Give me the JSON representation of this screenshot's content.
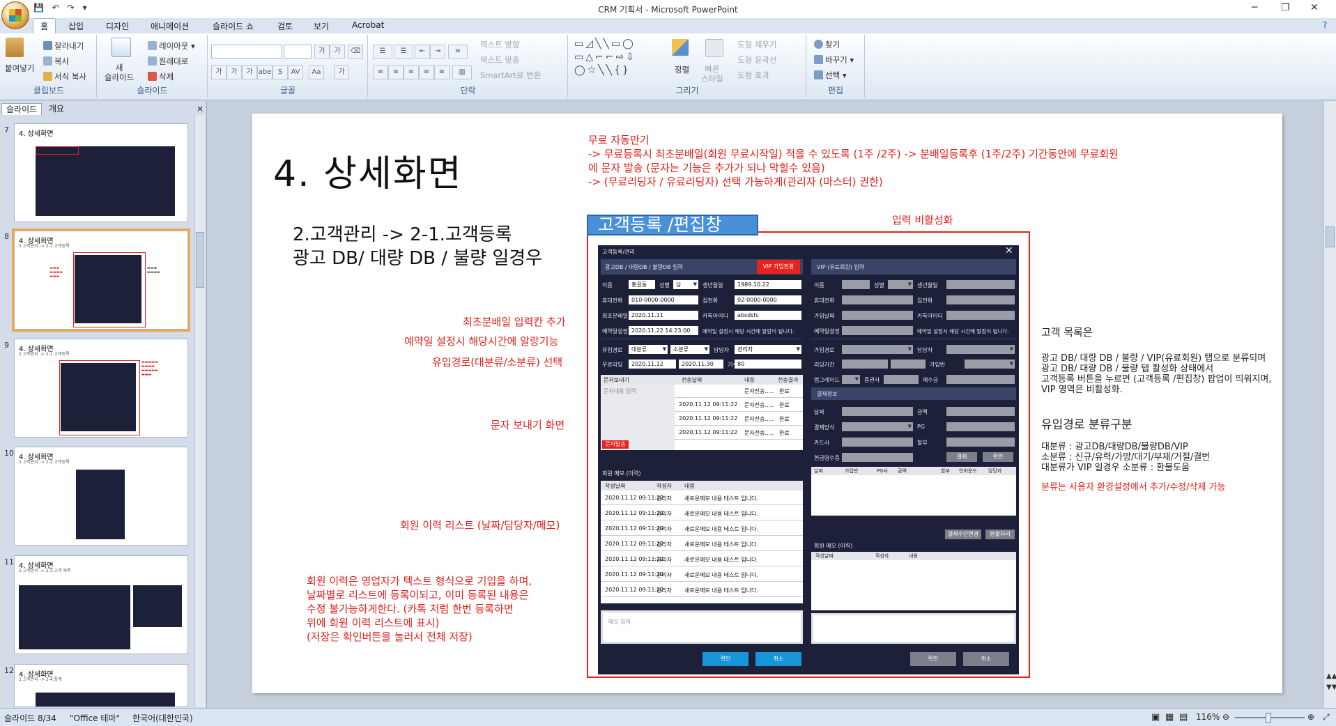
{
  "window": {
    "title": "CRM 기획서 - Microsoft PowerPoint",
    "minimize": "─",
    "restore": "❐",
    "close": "✕",
    "help": "?"
  },
  "qat": {
    "save": "💾",
    "undo": "↶",
    "redo": "↷",
    "more": "▾"
  },
  "tabs": [
    "홈",
    "삽입",
    "디자인",
    "애니메이션",
    "슬라이드 쇼",
    "검토",
    "보기",
    "Acrobat"
  ],
  "ribbon": {
    "clipboard": {
      "label": "클립보드",
      "paste": "붙여넣기",
      "cut": "잘라내기",
      "copy": "복사",
      "format_painter": "서식 복사"
    },
    "slides": {
      "label": "슬라이드",
      "new_slide": "새\n슬라이드",
      "layout": "레이아웃",
      "reset": "원래대로",
      "delete": "삭제"
    },
    "font": {
      "label": "글꼴",
      "grow": "가",
      "shrink": "가",
      "bold": "가",
      "italic": "가",
      "underline": "가",
      "strike": "abe",
      "shadow": "S",
      "spacing": "AV",
      "case": "Aa",
      "color": "가"
    },
    "paragraph": {
      "label": "단락",
      "text_direction": "텍스트 방향",
      "align_text": "텍스트 맞춤",
      "smartart": "SmartArt로 변환"
    },
    "drawing": {
      "label": "그리기",
      "arrange": "정렬",
      "quick_styles": "빠른\n스타일",
      "fill": "도형 채우기",
      "outline": "도형 윤곽선",
      "effects": "도형 효과"
    },
    "editing": {
      "label": "편집",
      "find": "찾기",
      "replace": "바꾸기",
      "select": "선택"
    }
  },
  "panel": {
    "tab_slides": "슬라이드",
    "tab_outline": "개요",
    "close": "×"
  },
  "thumbnails": [
    {
      "num": "7",
      "title": "4. 상세화면"
    },
    {
      "num": "8",
      "title": "4. 상세화면",
      "sub": "2.고객관리 -> 2-1.고객등록"
    },
    {
      "num": "9",
      "title": "4. 상세화면",
      "sub": "2.고객관리 -> 2-1.고객등록"
    },
    {
      "num": "10",
      "title": "4. 상세화면",
      "sub": "2.고객관리 -> 2-2.고객등록"
    },
    {
      "num": "11",
      "title": "4. 상세화면",
      "sub": "2.고객관리 -> 2-3.고객 목록"
    },
    {
      "num": "12",
      "title": "4. 상세화면",
      "sub": "2.고객관리 -> 2-4.통계"
    }
  ],
  "slide": {
    "title": "4. 상세화면",
    "subtitle1": "2.고객관리 -> 2-1.고객등록",
    "subtitle2": "광고 DB/ 대량 DB / 불량 일경우",
    "top_note": [
      "무료 자동만기",
      "-> 무료등록시 최초분배일(회원 무료시작일) 적을 수 있도록 (1주 /2주) -> 분배일등록후 (1주/2주) 기간동안에 무료회원",
      "에 문자 발송 (문자는 기능은 추가가 되나 막힐수 있음)",
      "-> (무료리딩자 / 유료리딩자) 선택 가능하게(관리자 (마스터) 권한)"
    ],
    "box_label": "고객등록 /편집창",
    "inactive_label": "입력 비활성화",
    "notes_left": [
      "최초분배일 입력칸 추가",
      "예약일 설정시 해당시간에 알랑기능",
      "유입경로(대분류/소분류) 선택"
    ],
    "sms_label": "문자 보내기 화면",
    "history_label": "회원 이력 리스트 (날짜/담당자/메모)",
    "history_note": [
      "회원 이력은 영업자가 텍스트 형식으로 기입을 하며,",
      "날짜별로 리스트에 등록이되고, 이미 등록된 내용은",
      "수정 불가능하게한다. (카톡 처럼 한번 등록하면",
      "위에 회원 이력 리스트에 표시)",
      "(저장은 확인버튼을 눌러서 전체 저장)"
    ],
    "right_heading1": "고객 목록은",
    "right_text1": [
      "광고 DB/ 대량 DB / 불량 / VIP(유료회원) 탭으로 분류되며",
      "광고 DB/ 대량 DB / 불량 탭 활성화 상태에서",
      "고객등록 버튼을 누르면 (고객등록 /편집창) 팝업이 띄워지며,",
      "VIP 영역은 비활성화."
    ],
    "right_heading2": "유입경로 분류구분",
    "right_text2": [
      "대분류 : 광고DB/대량DB/불량DB/VIP",
      "소분류 : 신규/유력/가망/대기/부재/거절/결번",
      "대분류가 VIP 일경우 소분류 : 환불도움"
    ],
    "right_note": "분류는 사용자 환경설정에서 추가/수정/삭제 가능"
  },
  "dialog": {
    "title": "고객등록/관리",
    "close": "✕",
    "tab_left": "광고DB / 대량DB / 불량DB 입력",
    "vip_button": "VIP 가입전환",
    "tab_right": "VIP (유료회원) 입력",
    "labels": {
      "name": "이름",
      "gender": "성별",
      "birth": "생년월일",
      "mobile": "휴대전화",
      "home": "집전화",
      "first_dist": "최초분배일",
      "kakao": "카톡아이디",
      "reservation": "예약일설정",
      "inflow": "유입경로",
      "manager": "담당자",
      "free_reading": "무료리딩",
      "period": "기수"
    },
    "values": {
      "name": "홍길동",
      "gender": "남",
      "birth": "1989.10.22",
      "mobile": "010-0000-0000",
      "home": "02-0000-0000",
      "first_dist": "2020.11.11",
      "kakao": "absdsfs",
      "reservation": "2020.11.22 14:23:00",
      "reservation_note": "예약일 설정시 해당 시간에 알람이 됩니다.",
      "inflow_major": "대분류",
      "inflow_minor": "소분류",
      "manager": "관리자",
      "free_from": "2020.11.12",
      "free_to": "2020.11.30",
      "period": "80"
    },
    "sms": {
      "header_send": "문자보내기",
      "header_date": "전송날짜",
      "header_content": "내용",
      "header_result": "전송결과",
      "placeholder": "문자내용 입력",
      "send_button": "문자발송",
      "rows": [
        [
          "",
          "문자전송.....",
          "완료"
        ],
        [
          "2020.11.12 09:11:22",
          "문자전송.....",
          "완료"
        ],
        [
          "2020.11.12 09:11:22",
          "문자전송.....",
          "완료"
        ],
        [
          "2020.11.12 09:11:22",
          "문자전송.....",
          "완료"
        ]
      ]
    },
    "memo": {
      "title": "회원 메모 (이력)",
      "h_date": "작성날짜",
      "h_writer": "작성자",
      "h_content": "내용",
      "rows": [
        [
          "2020.11.12 09:11:22",
          "관리자",
          "새로운메모 내용 테스트 입니다."
        ],
        [
          "2020.11.12 09:11:22",
          "관리자",
          "새로운메모 내용 테스트 입니다."
        ],
        [
          "2020.11.12 09:11:22",
          "관리자",
          "새로운메모 내용 테스트 입니다."
        ],
        [
          "2020.11.12 09:11:22",
          "관리자",
          "새로운메모 내용 테스트 입니다."
        ],
        [
          "2020.11.12 09:11:22",
          "관리자",
          "새로운메모 내용 테스트 입니다."
        ],
        [
          "2020.11.12 09:11:22",
          "관리자",
          "새로운메모 내용 테스트 입니다."
        ],
        [
          "2020.11.12 09:11:22",
          "관리자",
          "새로운메모 내용 테스트 입니다."
        ]
      ],
      "placeholder": "메모 입력"
    },
    "ok": "확인",
    "cancel": "취소",
    "vip": {
      "name": "이름",
      "gender": "성별",
      "birth": "생년월일",
      "mobile": "휴대전화",
      "home": "집전화",
      "join_date": "가입날짜",
      "kakao": "카톡아이디",
      "reservation": "예약일설정",
      "reservation_note": "예약일 설정시 해당 시간에 알람이 됩니다.",
      "path": "가입경로",
      "manager": "담당자",
      "period": "리딩기간",
      "product": "가입반",
      "upgrade": "업그레이드",
      "securities": "증권사",
      "deposit": "예수금",
      "pay_title": "결제정보",
      "pay_date": "날짜",
      "amount": "금액",
      "pay_method": "결제방식",
      "pg": "PG",
      "card": "카드사",
      "installment": "할부",
      "cash_receipt": "현금영수증",
      "pay_btn": "결제",
      "confirm_btn": "확인",
      "list_cols": [
        "날짜",
        "가입반",
        "PG사",
        "금액",
        "할부",
        "인바운드",
        "담당자"
      ],
      "change_method": "결제수단변경",
      "refund": "환불처리",
      "memo_title": "회원 메모 (이력)",
      "h_date": "작성날짜",
      "h_writer": "작성자",
      "h_content": "내용"
    }
  },
  "status": {
    "slide": "슬라이드 8/34",
    "theme": "\"Office 테마\"",
    "lang": "한국어(대한민국)",
    "zoom": "116%",
    "zoom_out": "⊖",
    "zoom_in": "⊕"
  },
  "colors": {
    "accent_red": "#e0201a",
    "dialog_bg": "#1c2039",
    "vip_red": "#e8231d",
    "ok_blue": "#1895d6",
    "selection_orange": "#f2a748"
  }
}
